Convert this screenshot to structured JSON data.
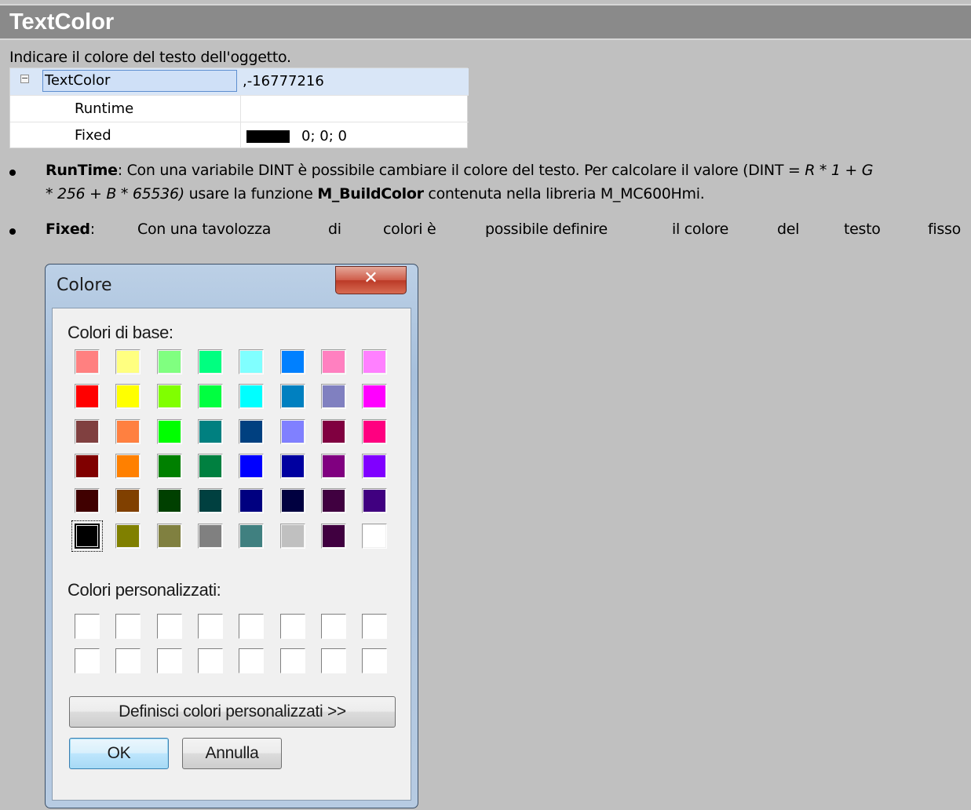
{
  "header": {
    "title": "TextColor"
  },
  "description": "Indicare il colore del testo dell'oggetto.",
  "property_grid": {
    "expander_symbol": "−",
    "row_main": {
      "name": "TextColor",
      "value": ",-16777216"
    },
    "row_runtime": {
      "name": "Runtime",
      "value": ""
    },
    "row_fixed": {
      "name": "Fixed",
      "value": "0; 0; 0",
      "swatch_color": "#000000"
    }
  },
  "bullets": {
    "runtime": {
      "term": "RunTime",
      "line1_a": ": Con una variabile DINT è possibile cambiare il colore del testo. Per calcolare il valore (DINT = ",
      "line1_formula": "R * 1 + G",
      "line2_formula": "* 256 + B * 65536)",
      "line2_a": " usare la funzione ",
      "function_name": "M_BuildColor",
      "line2_b": " contenuta nella libreria M_MC600Hmi."
    },
    "fixed": {
      "term": "Fixed",
      "colon": ":",
      "words": [
        "Con una tavolozza",
        "di",
        "colori è",
        "possibile definire",
        "il colore",
        "del",
        "testo",
        "fisso"
      ]
    }
  },
  "dialog": {
    "title": "Colore",
    "close_glyph": "✕",
    "basic_label": "Colori di base:",
    "basic_colors": [
      [
        "#ff8080",
        "#ffff80",
        "#80ff80",
        "#00ff80",
        "#80ffff",
        "#0080ff",
        "#ff80c0",
        "#ff80ff"
      ],
      [
        "#ff0000",
        "#ffff00",
        "#80ff00",
        "#00ff40",
        "#00ffff",
        "#0080c0",
        "#8080c0",
        "#ff00ff"
      ],
      [
        "#804040",
        "#ff8040",
        "#00ff00",
        "#008080",
        "#004080",
        "#8080ff",
        "#800040",
        "#ff0080"
      ],
      [
        "#800000",
        "#ff8000",
        "#008000",
        "#008040",
        "#0000ff",
        "#0000a0",
        "#800080",
        "#8000ff"
      ],
      [
        "#400000",
        "#804000",
        "#004000",
        "#004040",
        "#000080",
        "#000040",
        "#400040",
        "#400080"
      ],
      [
        "#000000",
        "#808000",
        "#808040",
        "#808080",
        "#408080",
        "#c0c0c0",
        "#400040",
        "#ffffff"
      ]
    ],
    "selected_color": "#000000",
    "custom_label": "Colori personalizzati:",
    "define_button": "Definisci colori personalizzati >>",
    "ok_button": "OK",
    "cancel_button": "Annulla"
  }
}
